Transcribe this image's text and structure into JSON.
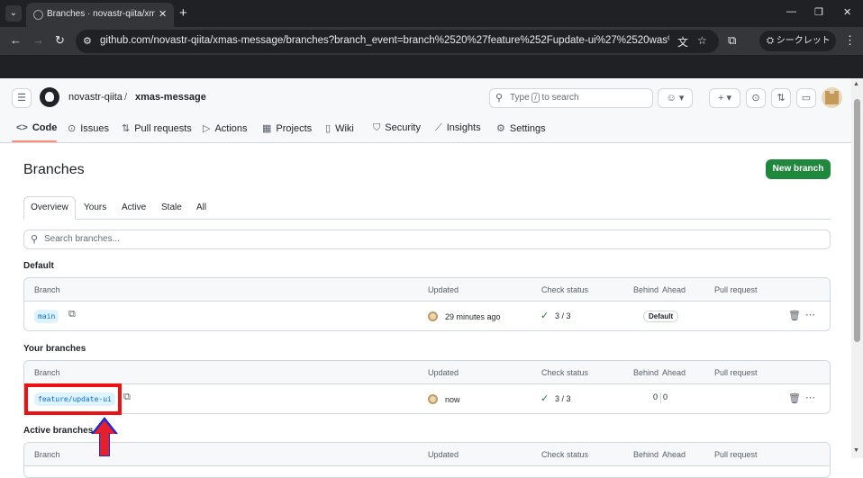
{
  "browser": {
    "tab_title": "Branches · novastr-qiita/xma",
    "tab_close": "✕",
    "new_tab": "+",
    "url": "github.com/novastr-qiita/xmas-message/branches?branch_event=branch%2520%27feature%252Fupdate-ui%27%2520was%2520cre...",
    "incognito_label": "シークレット",
    "window_controls": [
      "—",
      "❐",
      "✕"
    ]
  },
  "header": {
    "owner": "novastr-qiita",
    "separator": "/",
    "repo": "xmas-message",
    "search_prefix": "Type",
    "search_key": "/",
    "search_suffix": "to search"
  },
  "repo_nav": {
    "tabs": [
      {
        "label": "Code",
        "icon": "code-icon"
      },
      {
        "label": "Issues",
        "icon": "issue-icon"
      },
      {
        "label": "Pull requests",
        "icon": "pull-request-icon"
      },
      {
        "label": "Actions",
        "icon": "play-icon"
      },
      {
        "label": "Projects",
        "icon": "table-icon"
      },
      {
        "label": "Wiki",
        "icon": "book-icon"
      },
      {
        "label": "Security",
        "icon": "shield-icon"
      },
      {
        "label": "Insights",
        "icon": "graph-icon"
      },
      {
        "label": "Settings",
        "icon": "gear-icon"
      }
    ]
  },
  "page": {
    "title": "Branches",
    "new_branch": "New branch",
    "subtabs": [
      "Overview",
      "Yours",
      "Active",
      "Stale",
      "All"
    ],
    "search_placeholder": "Search branches..."
  },
  "columns": {
    "branch": "Branch",
    "updated": "Updated",
    "check_status": "Check status",
    "behind": "Behind",
    "ahead": "Ahead",
    "pull_request": "Pull request"
  },
  "sections": {
    "default": {
      "heading": "Default",
      "row": {
        "name": "main",
        "updated": "29 minutes ago",
        "checks": "3 / 3",
        "badge": "Default"
      }
    },
    "yours": {
      "heading": "Your branches",
      "row": {
        "name": "feature/update-ui",
        "updated": "now",
        "checks": "3 / 3",
        "behind": "0",
        "ahead": "0"
      }
    },
    "active": {
      "heading": "Active branches"
    }
  },
  "colors": {
    "accent_green": "#1f883d",
    "highlight_red": "#ee1111",
    "arrow_blue": "#1a2bd6"
  }
}
